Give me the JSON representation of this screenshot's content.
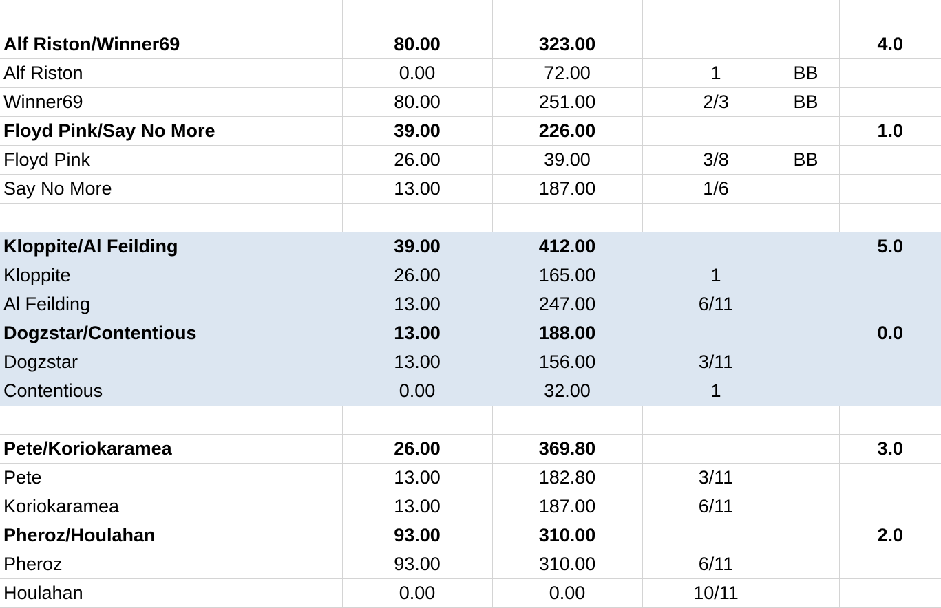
{
  "groups": [
    {
      "teams": [
        {
          "name": "Alf Riston/Winner69",
          "col1": "80.00",
          "col2": "323.00",
          "rank": "4.0",
          "players": [
            {
              "name": "Alf Riston",
              "col1": "0.00",
              "col2": "72.00",
              "col3": "1",
              "col4": "BB"
            },
            {
              "name": "Winner69",
              "col1": "80.00",
              "col2": "251.00",
              "col3": "2/3",
              "col4": "BB"
            }
          ]
        },
        {
          "name": "Floyd Pink/Say No More",
          "col1": "39.00",
          "col2": "226.00",
          "rank": "1.0",
          "players": [
            {
              "name": "Floyd Pink",
              "col1": "26.00",
              "col2": "39.00",
              "col3": "3/8",
              "col4": "BB"
            },
            {
              "name": "Say No More",
              "col1": "13.00",
              "col2": "187.00",
              "col3": "1/6",
              "col4": ""
            }
          ]
        }
      ]
    },
    {
      "teams": [
        {
          "name": "Kloppite/Al Feilding",
          "col1": "39.00",
          "col2": "412.00",
          "rank": "5.0",
          "players": [
            {
              "name": "Kloppite",
              "col1": "26.00",
              "col2": "165.00",
              "col3": "1",
              "col4": ""
            },
            {
              "name": "Al Feilding",
              "col1": "13.00",
              "col2": "247.00",
              "col3": "6/11",
              "col4": ""
            }
          ]
        },
        {
          "name": "Dogzstar/Contentious",
          "col1": "13.00",
          "col2": "188.00",
          "rank": "0.0",
          "players": [
            {
              "name": "Dogzstar",
              "col1": "13.00",
              "col2": "156.00",
              "col3": "3/11",
              "col4": ""
            },
            {
              "name": "Contentious",
              "col1": "0.00",
              "col2": "32.00",
              "col3": "1",
              "col4": ""
            }
          ]
        }
      ]
    },
    {
      "teams": [
        {
          "name": "Pete/Koriokaramea",
          "col1": "26.00",
          "col2": "369.80",
          "rank": "3.0",
          "players": [
            {
              "name": "Pete",
              "col1": "13.00",
              "col2": "182.80",
              "col3": "3/11",
              "col4": ""
            },
            {
              "name": "Koriokaramea",
              "col1": "13.00",
              "col2": "187.00",
              "col3": "6/11",
              "col4": ""
            }
          ]
        },
        {
          "name": "Pheroz/Houlahan",
          "col1": "93.00",
          "col2": "310.00",
          "rank": "2.0",
          "players": [
            {
              "name": "Pheroz",
              "col1": "93.00",
              "col2": "310.00",
              "col3": "6/11",
              "col4": ""
            },
            {
              "name": "Houlahan",
              "col1": "0.00",
              "col2": "0.00",
              "col3": "10/11",
              "col4": ""
            }
          ]
        }
      ]
    }
  ],
  "colors": {
    "shade": "#dce6f1",
    "gridline": "#d4d4d4"
  }
}
